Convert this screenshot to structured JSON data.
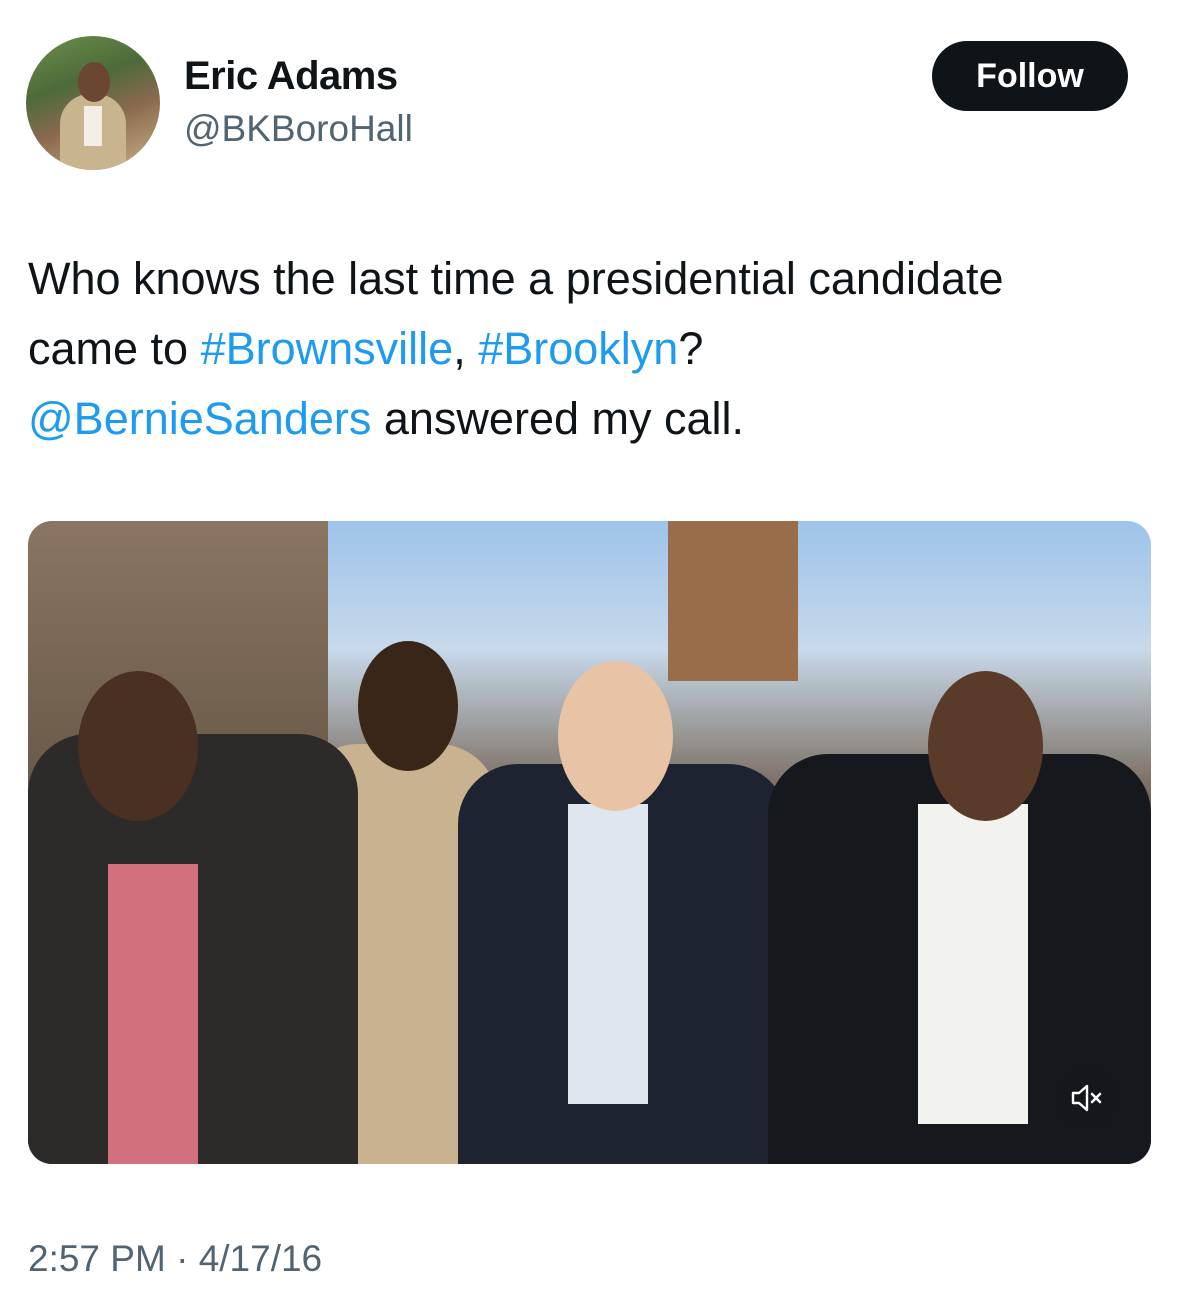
{
  "author": {
    "name": "Eric Adams",
    "handle": "@BKBoroHall"
  },
  "follow_label": "Follow",
  "tweet": {
    "line1": "Who knows the last time a presidential candidate",
    "line2_prefix": "came to ",
    "hashtag1": "#Brownsville",
    "line2_sep": ", ",
    "hashtag2": "#Brooklyn",
    "line2_suffix": "?",
    "mention": "@BernieSanders",
    "line3_suffix": " answered my call."
  },
  "media": {
    "mute_icon": "speaker-muted-icon"
  },
  "meta": {
    "time": "2:57 PM",
    "separator": " · ",
    "date": "4/17/16"
  },
  "colors": {
    "link": "#1d9bf0",
    "text": "#0f1419",
    "secondary": "#536471",
    "button_bg": "#0f1419"
  }
}
